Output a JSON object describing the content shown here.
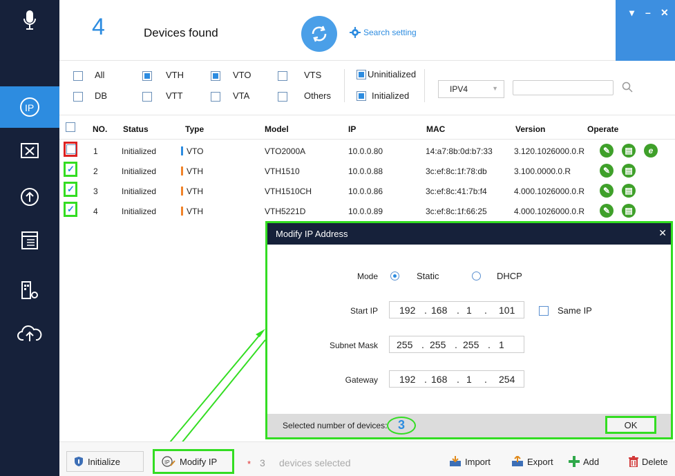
{
  "header": {
    "count": "4",
    "title": "Devices found",
    "search_setting": "Search setting"
  },
  "filters": {
    "all": "All",
    "vth": "VTH",
    "vto": "VTO",
    "vts": "VTS",
    "db": "DB",
    "vtt": "VTT",
    "vta": "VTA",
    "others": "Others",
    "uninitialized": "Uninitialized",
    "initialized": "Initialized",
    "ip_version": "IPV4"
  },
  "table": {
    "headers": [
      "NO.",
      "Status",
      "Type",
      "Model",
      "IP",
      "MAC",
      "Version",
      "Operate"
    ],
    "rows": [
      {
        "no": "1",
        "status": "Initialized",
        "type": "VTO",
        "model": "VTO2000A",
        "ip": "10.0.0.80",
        "mac": "14:a7:8b:0d:b7:33",
        "version": "3.120.1026000.0.R",
        "checked": false
      },
      {
        "no": "2",
        "status": "Initialized",
        "type": "VTH",
        "model": "VTH1510",
        "ip": "10.0.0.88",
        "mac": "3c:ef:8c:1f:78:db",
        "version": "3.100.0000.0.R",
        "checked": true
      },
      {
        "no": "3",
        "status": "Initialized",
        "type": "VTH",
        "model": "VTH1510CH",
        "ip": "10.0.0.86",
        "mac": "3c:ef:8c:41:7b:f4",
        "version": "4.000.1026000.0.R",
        "checked": true
      },
      {
        "no": "4",
        "status": "Initialized",
        "type": "VTH",
        "model": "VTH5221D",
        "ip": "10.0.0.89",
        "mac": "3c:ef:8c:1f:66:25",
        "version": "4.000.1026000.0.R",
        "checked": true
      }
    ]
  },
  "colors": {
    "vto": "#2d8ce0",
    "vth": "#f0832a",
    "highlight": "#33dd22",
    "accent": "#2d8ce0"
  },
  "dialog": {
    "title": "Modify IP Address",
    "mode_label": "Mode",
    "static_label": "Static",
    "dhcp_label": "DHCP",
    "start_ip_label": "Start IP",
    "start_ip": [
      "192",
      "168",
      "1",
      "101"
    ],
    "same_ip_label": "Same IP",
    "subnet_label": "Subnet Mask",
    "subnet": [
      "255",
      "255",
      "255",
      "1"
    ],
    "gateway_label": "Gateway",
    "gateway": [
      "192",
      "168",
      "1",
      "254"
    ],
    "selected_label": "Selected number of devices:",
    "selected_count": "3",
    "ok_label": "OK"
  },
  "bottom": {
    "initialize": "Initialize",
    "modify_ip": "Modify IP",
    "star": "*",
    "selected_count": "3",
    "selected_text": "devices selected",
    "import": "Import",
    "export": "Export",
    "add": "Add",
    "delete": "Delete"
  }
}
